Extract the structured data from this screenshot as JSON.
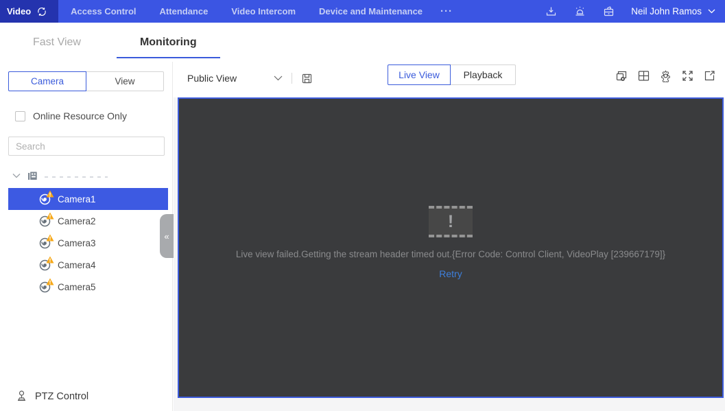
{
  "topnav": {
    "active_label": "Video",
    "items": [
      "Access Control",
      "Attendance",
      "Video Intercom",
      "Device and Maintenance"
    ],
    "more_label": "···",
    "user_name": "Neil John Ramos"
  },
  "tabs": {
    "fast_view": "Fast View",
    "monitoring": "Monitoring"
  },
  "sidebar": {
    "tab_camera": "Camera",
    "tab_view": "View",
    "online_resource_label": "Online Resource Only",
    "online_resource_checked": false,
    "search_placeholder": "Search",
    "search_value": "",
    "tree": {
      "root_label_redacted": "",
      "cameras": [
        {
          "label": "Camera1",
          "selected": true,
          "warning": true
        },
        {
          "label": "Camera2",
          "selected": false,
          "warning": true
        },
        {
          "label": "Camera3",
          "selected": false,
          "warning": true
        },
        {
          "label": "Camera4",
          "selected": false,
          "warning": true
        },
        {
          "label": "Camera5",
          "selected": false,
          "warning": true
        }
      ]
    },
    "ptz_label": "PTZ Control"
  },
  "toolbar": {
    "view_name": "Public View",
    "live_view_label": "Live View",
    "playback_label": "Playback",
    "icons": [
      "close-all-windows",
      "window-division",
      "settings",
      "fullscreen",
      "open-in-new-window"
    ]
  },
  "player": {
    "error_text": "Live view failed.Getting the stream header timed out.{Error Code: Control Client, VideoPlay [239667179]}",
    "retry_label": "Retry"
  },
  "colors": {
    "topnav_bg": "#3B55E3",
    "topnav_active_bg": "#2433AE",
    "accent_blue": "#3A5BDB",
    "selected_row_bg": "#3D5AE2",
    "warning_orange": "#F6A818",
    "video_bg": "#3A3B3D",
    "video_border": "#3D5BDC",
    "error_text_gray": "#8A8B8D",
    "retry_link_blue": "#3E7FDC"
  }
}
